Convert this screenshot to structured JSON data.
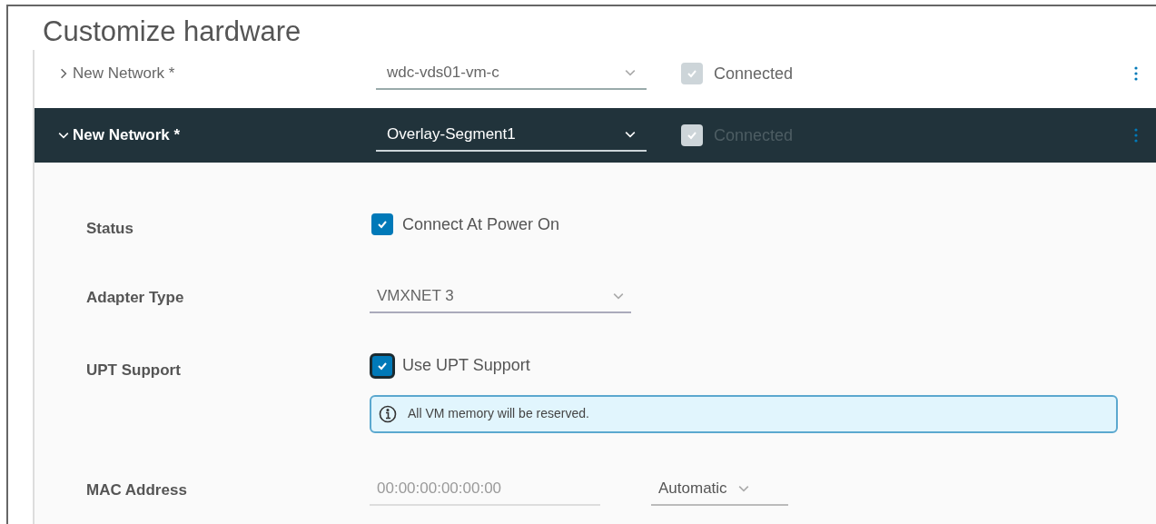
{
  "title": "Customize hardware",
  "networks": [
    {
      "label": "New Network *",
      "expanded": false,
      "network": "wdc-vds01-vm-c",
      "connected": {
        "label": "Connected",
        "checked": true
      }
    },
    {
      "label": "New Network *",
      "expanded": true,
      "network": "Overlay-Segment1",
      "connected": {
        "label": "Connected",
        "checked": true
      }
    }
  ],
  "details": [
    {
      "kind": "checkbox",
      "label": "Status",
      "option": "Connect At Power On",
      "checked": true,
      "focused": false
    },
    {
      "kind": "select",
      "label": "Adapter Type",
      "value": "VMXNET 3"
    },
    {
      "kind": "checkbox",
      "label": "UPT Support",
      "option": "Use UPT Support",
      "checked": true,
      "focused": true,
      "info": "All VM memory will be reserved."
    },
    {
      "kind": "mac",
      "label": "MAC Address",
      "placeholder": "00:00:00:00:00:00",
      "mode": "Automatic"
    }
  ]
}
